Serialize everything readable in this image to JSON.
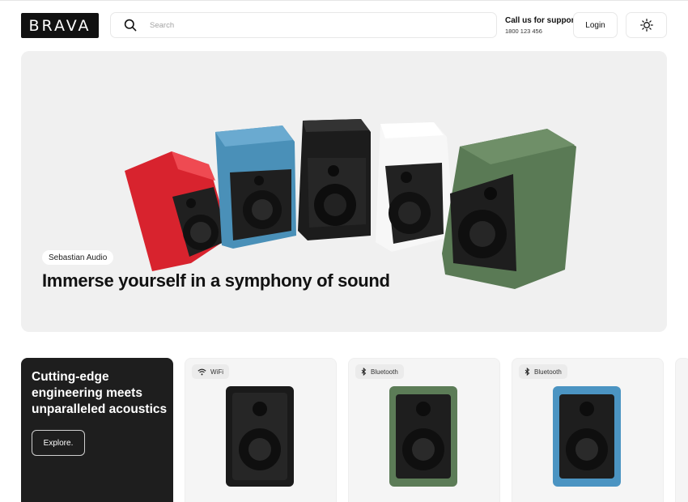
{
  "header": {
    "logo": "BRAVA",
    "search_placeholder": "Search",
    "support_title": "Call us for support",
    "support_phone": "1800 123 456",
    "login_label": "Login"
  },
  "hero": {
    "brand": "Sebastian Audio",
    "headline": "Immerse yourself in a symphony of sound",
    "speaker_colors": [
      "#d8232e",
      "#4a90b8",
      "#1c1c1c",
      "#f1f1f1",
      "#5a7a55"
    ]
  },
  "promo": {
    "headline": "Cutting-edge engineering meets unparalleled acoustics",
    "cta_label": "Explore."
  },
  "products": [
    {
      "tag": "WiFi",
      "tag_icon": "wifi-icon",
      "color": "#1a1a1a"
    },
    {
      "tag": "Bluetooth",
      "tag_icon": "bluetooth-icon",
      "color": "#5c7c57"
    },
    {
      "tag": "Bluetooth",
      "tag_icon": "bluetooth-icon",
      "color": "#4b94c2"
    }
  ]
}
